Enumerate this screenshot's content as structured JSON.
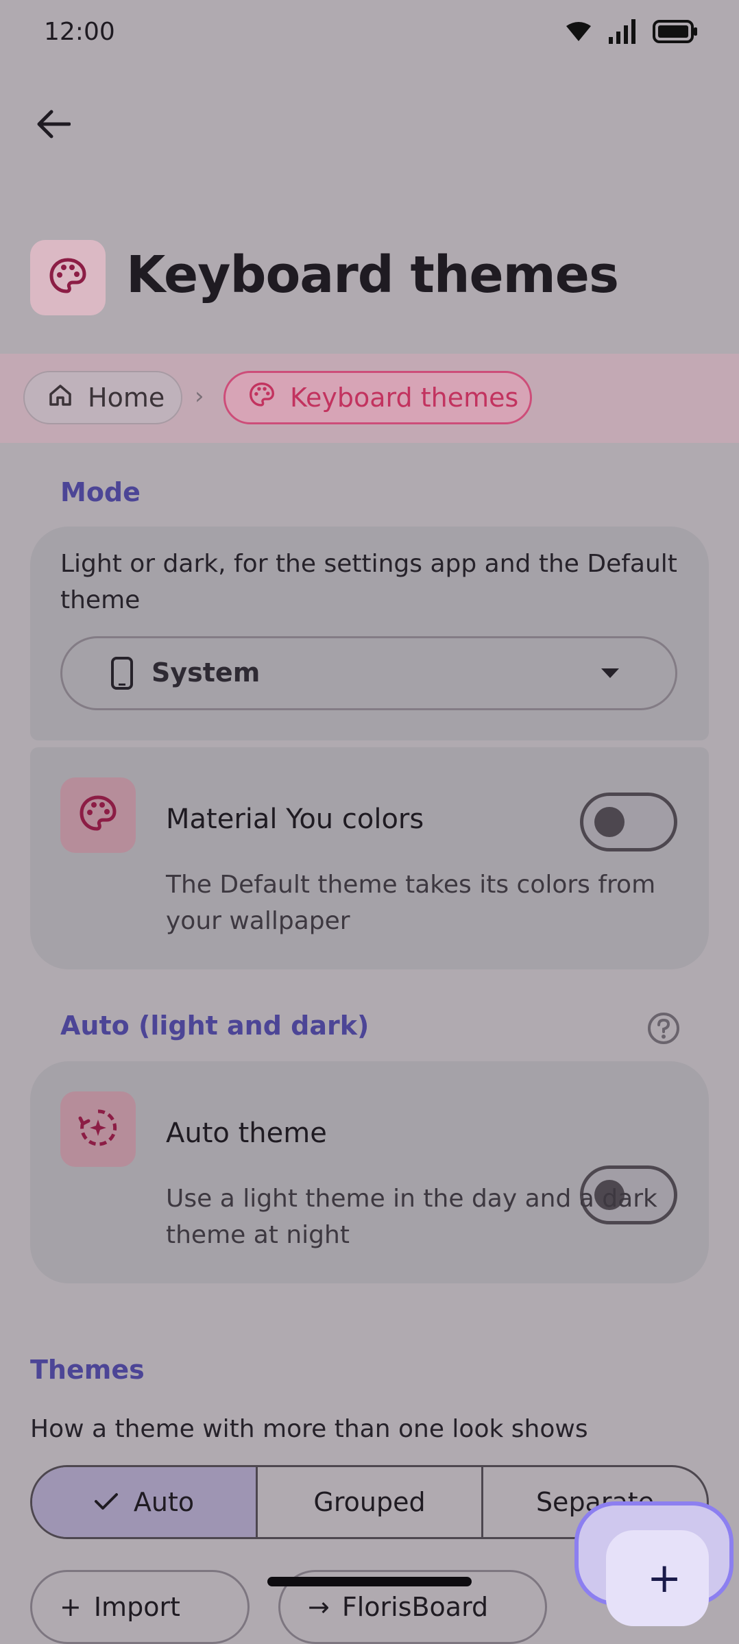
{
  "status_bar": {
    "time": "12:00"
  },
  "header": {
    "title": "Keyboard themes"
  },
  "breadcrumb": {
    "home": "Home",
    "separator": "›",
    "current": "Keyboard themes"
  },
  "mode": {
    "header": "Mode",
    "description": "Light or dark, for the settings app and the Default theme",
    "dropdown_value": "System",
    "material_you": {
      "title": "Material You colors",
      "description": "The Default theme takes its colors from your wallpaper",
      "enabled": false
    }
  },
  "auto": {
    "header": "Auto (light and dark)",
    "item": {
      "title": "Auto theme",
      "description": "Use a light theme in the day and a dark theme at night",
      "enabled": false
    }
  },
  "themes": {
    "header": "Themes",
    "description": "How a theme with more than one look shows",
    "options": [
      "Auto",
      "Grouped",
      "Separate"
    ],
    "selected": "Auto",
    "bottom_buttons": [
      "Import",
      "FlorisBoard"
    ]
  },
  "fab": {
    "symbol": "+"
  },
  "colors": {
    "accent": "#4c4596",
    "pink": "#c2335f"
  }
}
